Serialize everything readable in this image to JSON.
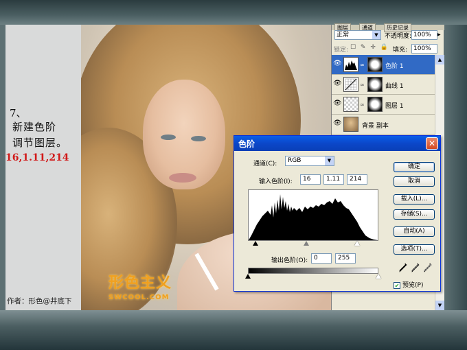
{
  "caption": {
    "step": "7、",
    "lines": [
      "新建色阶",
      "调节图层。"
    ],
    "values": "16,1.11,214",
    "author": "作者：形色@井底下"
  },
  "watermark": {
    "big": "形色主义",
    "small": "SWCOOL.COM"
  },
  "layers_panel": {
    "tabs": [
      "图层",
      "通道",
      "历史记录"
    ],
    "blend_mode": "正常",
    "opacity_label": "不透明度:",
    "opacity_value": "100%",
    "lock_label": "锁定:",
    "lock_icons": "☐ ✎ ✛ 🔒",
    "fill_label": "填充:",
    "fill_value": "100%",
    "layers": [
      {
        "name": "色阶 1",
        "active": true
      },
      {
        "name": "曲线 1",
        "active": false
      },
      {
        "name": "图层 1",
        "active": false
      },
      {
        "name": "背景 副本",
        "active": false
      }
    ]
  },
  "levels_dialog": {
    "title": "色阶",
    "channel_label": "通道(C):",
    "channel_value": "RGB",
    "input_label": "输入色阶(I):",
    "input_black": "16",
    "input_gamma": "1.11",
    "input_white": "214",
    "output_label": "输出色阶(O):",
    "output_black": "0",
    "output_white": "255",
    "buttons": {
      "ok": "确定",
      "cancel": "取消",
      "load": "载入(L)...",
      "save": "存储(S)...",
      "auto": "自动(A)",
      "options": "选项(T)..."
    },
    "preview_label": "预览(P)",
    "preview_checked": true,
    "input_slider_positions": [
      16,
      114,
      214
    ],
    "output_slider_positions": [
      0,
      255
    ]
  },
  "colors": {
    "dialog_title_bar": "#0a5ee8",
    "layer_selected": "#316ac5",
    "caption_values": "#d11a1a"
  }
}
